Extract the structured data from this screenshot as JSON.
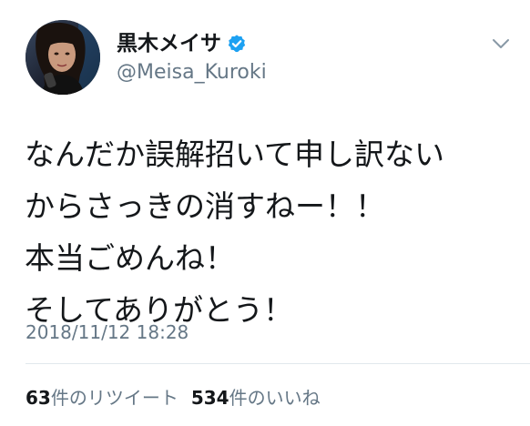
{
  "user": {
    "display_name": "黒木メイサ",
    "handle": "@Meisa_Kuroki",
    "verified": true
  },
  "tweet": {
    "lines": [
      "なんだか誤解招いて申し訳ない",
      "からさっきの消すねー！！",
      "本当ごめんね！",
      "そしてありがとう！"
    ],
    "timestamp": "2018/11/12 18:28"
  },
  "stats": {
    "retweets": {
      "count": "63",
      "label": "件のリツイート"
    },
    "likes": {
      "count": "534",
      "label": "件のいいね"
    }
  },
  "colors": {
    "text": "#14171a",
    "secondary": "#657786",
    "verified": "#1da1f2",
    "divider": "#e1e8ed"
  },
  "icons": {
    "verified": "verified-badge-icon",
    "menu": "chevron-down-icon"
  }
}
